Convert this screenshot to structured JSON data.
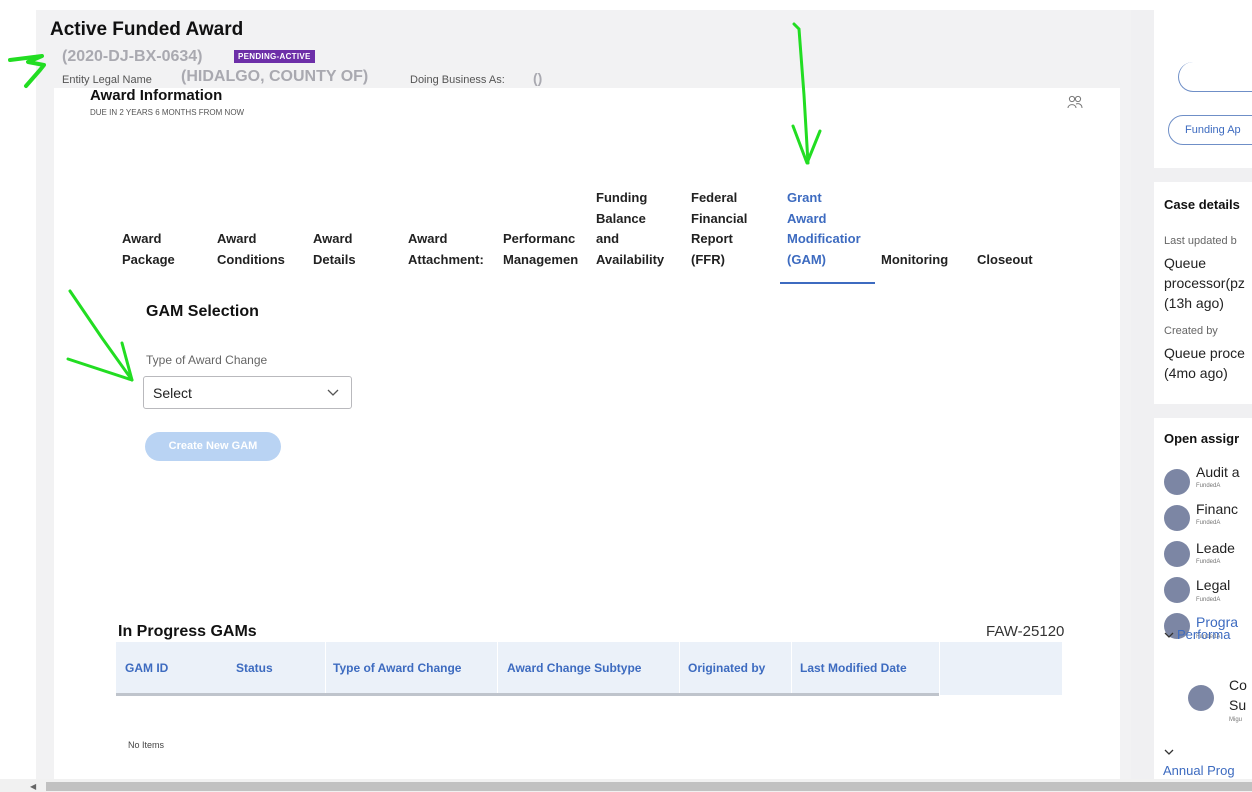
{
  "header": {
    "title": "Active Funded Award",
    "award_id": "(2020-DJ-BX-0634)",
    "status_badge": "PENDING-ACTIVE",
    "entity_label": "Entity Legal Name",
    "entity_value": "(HIDALGO, COUNTY OF)",
    "dba_label": "Doing Business As:",
    "dba_value": "()"
  },
  "section": {
    "title": "Award Information",
    "due": "DUE IN 2 YEARS 6 MONTHS FROM NOW"
  },
  "tabs": [
    {
      "label": "Award\nPackage"
    },
    {
      "label": "Award\nConditions"
    },
    {
      "label": "Award\nDetails"
    },
    {
      "label": "Award\nAttachment:"
    },
    {
      "label": "Performanc\nManagemen"
    },
    {
      "label": "Funding\nBalance\nand\nAvailability"
    },
    {
      "label": "Federal\nFinancial\nReport\n(FFR)"
    },
    {
      "label": "Grant\nAward\nModificatior\n(GAM)"
    },
    {
      "label": "Monitoring"
    },
    {
      "label": "Closeout"
    }
  ],
  "gam_selection": {
    "title": "GAM Selection",
    "field_label": "Type of Award Change",
    "select_value": "Select",
    "create_button": "Create New GAM"
  },
  "in_progress": {
    "title": "In Progress GAMs",
    "code": "FAW-25120",
    "columns": [
      "GAM ID",
      "Status",
      "Type of Award Change",
      "Award Change Subtype",
      "Originated by",
      "Last Modified Date"
    ],
    "empty_text": "No Items"
  },
  "right_panel": {
    "funding_button": "Funding Ap",
    "case_details": {
      "heading": "Case details",
      "updated_label": "Last updated b",
      "updated_lines": [
        "Queue",
        "processor(pz",
        "(13h ago)"
      ],
      "created_label": "Created by",
      "created_lines": [
        "Queue proce",
        "(4mo ago)"
      ]
    },
    "open_assignments": {
      "heading": "Open assigr",
      "items": [
        {
          "title": "Audit a",
          "sub": "FundedA"
        },
        {
          "title": "Financ",
          "sub": "FundedA"
        },
        {
          "title": "Leade",
          "sub": "FundedA"
        },
        {
          "title": "Legal",
          "sub": "FundedA"
        },
        {
          "title": "Progra",
          "sub": "FundedA"
        }
      ],
      "group_label": "Performa",
      "nested": {
        "line1": "Co",
        "line2": "Su",
        "sub": "Migu"
      },
      "footer_link": "Annual Prog"
    }
  },
  "colors": {
    "accent": "#3d6bc0",
    "badge": "#6d2fa8",
    "annotation": "#22dd22",
    "button_disabled": "#b9d3f3"
  }
}
